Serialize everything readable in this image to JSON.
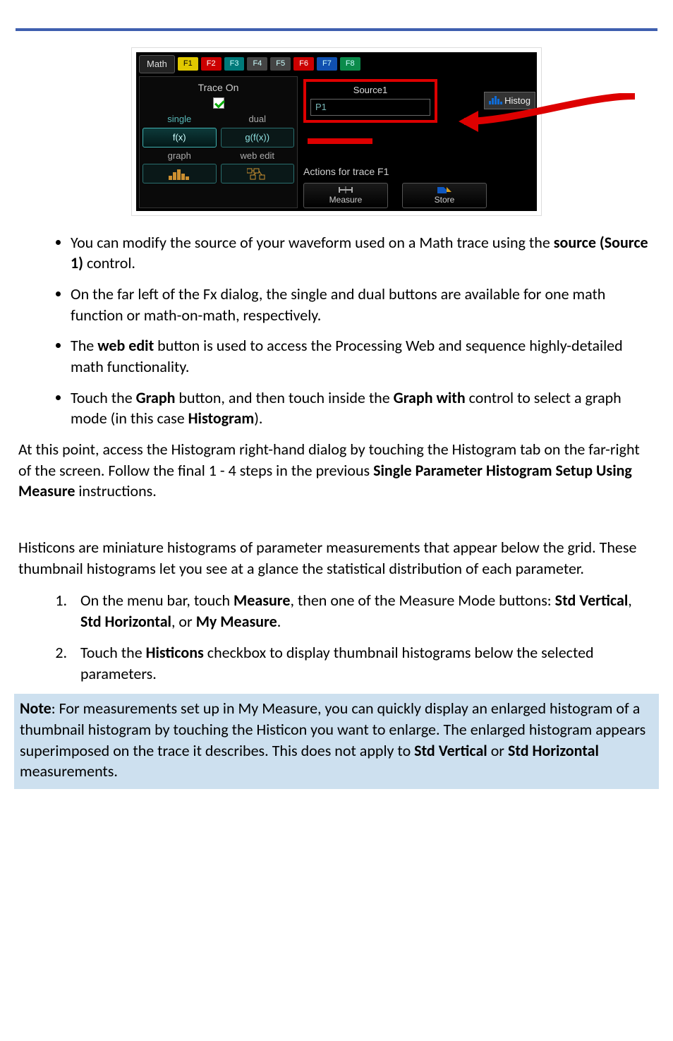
{
  "screenshot": {
    "math_tab": "Math",
    "ftabs": [
      "F1",
      "F2",
      "F3",
      "F4",
      "F5",
      "F6",
      "F7",
      "F8"
    ],
    "trace_on_label": "Trace On",
    "mode_labels": {
      "single": "single",
      "dual": "dual",
      "graph": "graph",
      "webedit": "web edit"
    },
    "mode_btn": {
      "single": "f(x)",
      "dual": "g(f(x))"
    },
    "source": {
      "label": "Source1",
      "value": "P1"
    },
    "histog_btn": "Histog",
    "actions_label": "Actions for trace F1",
    "action_measure": "Measure",
    "action_store": "Store"
  },
  "bullets": [
    {
      "pre": "You can modify the source of your waveform used on a Math trace using the ",
      "b1": "source (Source 1)",
      "post": " control."
    },
    {
      "pre": "On the far left of the Fx dialog, the single and dual buttons are available for one math function or math-on-math, respectively."
    },
    {
      "pre": "The ",
      "b1": "web edit",
      "mid": " button is used to access the Processing Web and sequence highly-detailed math functionality."
    },
    {
      "pre": "Touch the ",
      "b1": "Graph",
      "mid": " button, and then touch inside the ",
      "b2": "Graph with",
      "mid2": " control to select a graph mode (in this case ",
      "b3": "Histogram",
      "post": ")."
    }
  ],
  "para1": {
    "pre": "At this point, access the Histogram right-hand dialog by touching the Histogram tab on the far-right of the screen. Follow the final 1 - 4 steps in the previous ",
    "b1": "Single Parameter Histogram Setup Using Measure",
    "post": " instructions."
  },
  "para2": "Histicons are miniature histograms of parameter measurements that appear below the grid. These thumbnail histograms let you see at a glance the statistical distribution of each parameter.",
  "steps": [
    {
      "pre": "On the menu bar, touch ",
      "b1": "Measure",
      "mid": ", then one of the Measure Mode buttons: ",
      "b2": "Std Vertical",
      "sep1": ", ",
      "b3": "Std Horizontal",
      "sep2": ", or ",
      "b4": "My Measure",
      "post": "."
    },
    {
      "pre": "Touch the ",
      "b1": "Histicons",
      "post": " checkbox to display thumbnail histograms below the selected parameters."
    }
  ],
  "note": {
    "b0": "Note",
    "pre": ": For measurements set up in My Measure, you can quickly display an enlarged histogram of a thumbnail histogram by touching the Histicon you want to enlarge. The enlarged histogram appears superimposed on the trace it describes. This does not apply to ",
    "b1": "Std Vertical",
    "mid": " or ",
    "b2": "Std Horizontal",
    "post": " measurements."
  }
}
